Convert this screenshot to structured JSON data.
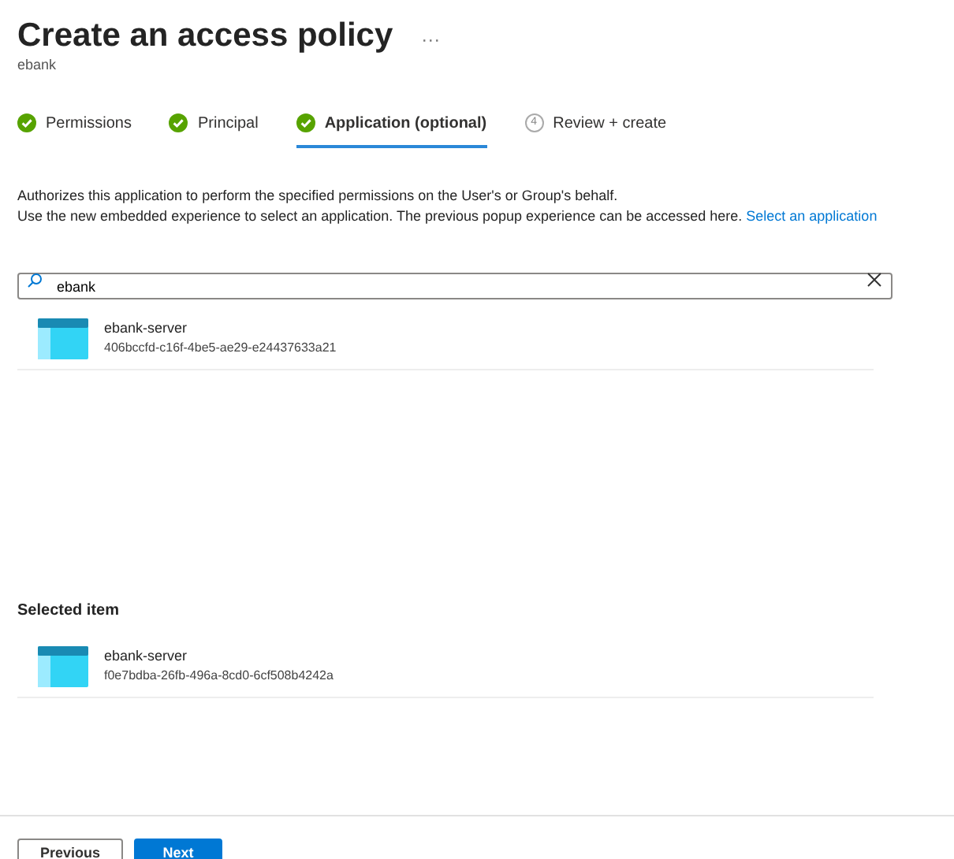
{
  "header": {
    "title": "Create an access policy",
    "more": "···",
    "subtitle": "ebank"
  },
  "steps": [
    {
      "label": "Permissions",
      "kind": "done",
      "selected": false
    },
    {
      "label": "Principal",
      "kind": "done",
      "selected": false
    },
    {
      "label": "Application (optional)",
      "kind": "done",
      "selected": true
    },
    {
      "label": "Review + create",
      "kind": "numbered",
      "number": "4",
      "selected": false
    }
  ],
  "description": {
    "line_1": "Authorizes this application to perform the specified permissions on the User's or Group's behalf.",
    "line_2": "Use the new embedded experience to select an application. The previous popup experience can be accessed here.",
    "link": "Select an application"
  },
  "search": {
    "value": "ebank"
  },
  "results": [
    {
      "name": "ebank-server",
      "id": "406bccfd-c16f-4be5-ae29-e24437633a21"
    }
  ],
  "selected_section": {
    "heading": "Selected item",
    "items": [
      {
        "name": "ebank-server",
        "id": "f0e7bdba-26fb-496a-8cd0-6cf508b4242a"
      }
    ]
  },
  "buttons": [
    {
      "label": "Previous",
      "kind": "secondary"
    },
    {
      "label": "Next",
      "kind": "primary"
    }
  ]
}
